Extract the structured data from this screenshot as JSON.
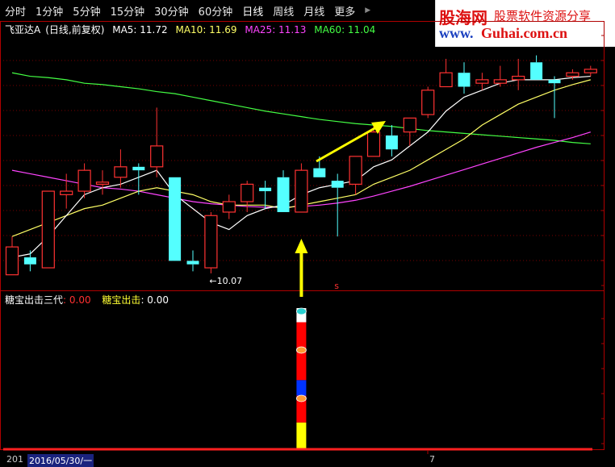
{
  "toolbar": {
    "tabs": [
      "分时",
      "1分钟",
      "5分钟",
      "15分钟",
      "30分钟",
      "60分钟",
      "日线",
      "周线",
      "月线",
      "更多"
    ],
    "active": "日线",
    "more_arrow": "▶"
  },
  "logo": {
    "name": "股海网",
    "slogan": "股票软件资源分享",
    "url_prefix": "www.",
    "url_domain": "Guhai.com.cn"
  },
  "main_info": {
    "stock": "飞亚达A",
    "mode": "(日线,前复权)",
    "ma5": "MA5: 11.72",
    "ma10": "MA10: 11.69",
    "ma25": "MA25: 11.13",
    "ma60": "MA60: 11.04",
    "colors": {
      "stock": "#ffffff",
      "ma5": "#ffffff",
      "ma10": "#ffff66",
      "ma25": "#ff44ff",
      "ma60": "#44ff44"
    }
  },
  "low_marker": "←10.07",
  "s_marker": "s",
  "indicator": {
    "name1": "糖宝出击三代",
    "val1": ": 0.00",
    "name2": "糖宝出击",
    "val2": ": 0.00"
  },
  "status": {
    "year_prefix": "201",
    "date": "2016/05/30/一",
    "tick_label": "7"
  },
  "chart_data": {
    "type": "candlestick",
    "candles": [
      {
        "o": 10.05,
        "c": 10.45,
        "h": 10.6,
        "l": 10.05
      },
      {
        "o": 10.3,
        "c": 10.2,
        "h": 10.4,
        "l": 10.1
      },
      {
        "o": 10.15,
        "c": 11.25,
        "h": 11.25,
        "l": 10.15
      },
      {
        "o": 11.2,
        "c": 11.25,
        "h": 11.5,
        "l": 11.0
      },
      {
        "o": 11.25,
        "c": 11.55,
        "h": 11.65,
        "l": 11.15
      },
      {
        "o": 11.35,
        "c": 11.38,
        "h": 11.55,
        "l": 11.2
      },
      {
        "o": 11.45,
        "c": 11.6,
        "h": 11.85,
        "l": 11.3
      },
      {
        "o": 11.6,
        "c": 11.55,
        "h": 11.65,
        "l": 11.2
      },
      {
        "o": 11.6,
        "c": 11.9,
        "h": 12.45,
        "l": 11.45
      },
      {
        "o": 11.45,
        "c": 10.25,
        "h": 11.45,
        "l": 10.25
      },
      {
        "o": 10.25,
        "c": 10.2,
        "h": 10.4,
        "l": 10.1
      },
      {
        "o": 10.15,
        "c": 10.9,
        "h": 10.95,
        "l": 10.07
      },
      {
        "o": 10.95,
        "c": 11.1,
        "h": 11.2,
        "l": 10.85
      },
      {
        "o": 11.1,
        "c": 11.35,
        "h": 11.4,
        "l": 10.95
      },
      {
        "o": 11.3,
        "c": 11.25,
        "h": 11.4,
        "l": 11.0
      },
      {
        "o": 11.45,
        "c": 10.95,
        "h": 11.55,
        "l": 10.95
      },
      {
        "o": 10.95,
        "c": 11.55,
        "h": 11.65,
        "l": 10.95
      },
      {
        "o": 11.58,
        "c": 11.45,
        "h": 11.75,
        "l": 11.45
      },
      {
        "o": 11.4,
        "c": 11.3,
        "h": 11.5,
        "l": 10.6
      },
      {
        "o": 11.35,
        "c": 11.75,
        "h": 11.75,
        "l": 11.2
      },
      {
        "o": 11.75,
        "c": 12.1,
        "h": 12.2,
        "l": 11.75
      },
      {
        "o": 12.05,
        "c": 11.85,
        "h": 12.2,
        "l": 11.75
      },
      {
        "o": 12.1,
        "c": 12.3,
        "h": 12.3,
        "l": 11.9
      },
      {
        "o": 12.35,
        "c": 12.7,
        "h": 12.75,
        "l": 12.3
      },
      {
        "o": 12.75,
        "c": 12.95,
        "h": 13.15,
        "l": 12.75
      },
      {
        "o": 12.95,
        "c": 12.75,
        "h": 13.1,
        "l": 12.65
      },
      {
        "o": 12.8,
        "c": 12.85,
        "h": 12.95,
        "l": 12.7
      },
      {
        "o": 12.8,
        "c": 12.85,
        "h": 13.05,
        "l": 12.75
      },
      {
        "o": 12.85,
        "c": 12.9,
        "h": 13.15,
        "l": 12.7
      },
      {
        "o": 13.1,
        "c": 12.85,
        "h": 13.2,
        "l": 12.85
      },
      {
        "o": 12.85,
        "c": 12.8,
        "h": 12.9,
        "l": 12.3
      },
      {
        "o": 12.9,
        "c": 12.95,
        "h": 13.0,
        "l": 12.85
      },
      {
        "o": 12.95,
        "c": 13.0,
        "h": 13.05,
        "l": 12.9
      }
    ],
    "ma5": [
      10.3,
      10.35,
      10.6,
      10.9,
      11.2,
      11.3,
      11.35,
      11.45,
      11.55,
      11.2,
      11.0,
      10.8,
      10.7,
      10.9,
      11.0,
      11.05,
      11.2,
      11.3,
      11.35,
      11.4,
      11.6,
      11.7,
      11.9,
      12.1,
      12.4,
      12.6,
      12.7,
      12.8,
      12.85,
      12.85,
      12.85,
      12.88,
      12.9
    ],
    "ma10": [
      10.6,
      10.7,
      10.8,
      10.9,
      11.0,
      11.05,
      11.15,
      11.25,
      11.3,
      11.25,
      11.2,
      11.1,
      11.05,
      11.05,
      11.05,
      11.0,
      11.05,
      11.1,
      11.15,
      11.2,
      11.35,
      11.45,
      11.55,
      11.7,
      11.85,
      12.0,
      12.2,
      12.35,
      12.5,
      12.6,
      12.7,
      12.78,
      12.85
    ],
    "ma25": [
      11.55,
      11.5,
      11.45,
      11.4,
      11.35,
      11.3,
      11.28,
      11.25,
      11.2,
      11.15,
      11.1,
      11.07,
      11.05,
      11.03,
      11.02,
      11.02,
      11.03,
      11.05,
      11.08,
      11.12,
      11.18,
      11.25,
      11.32,
      11.4,
      11.48,
      11.56,
      11.64,
      11.72,
      11.8,
      11.88,
      11.95,
      12.02,
      12.1
    ],
    "ma60": [
      12.95,
      12.9,
      12.88,
      12.85,
      12.8,
      12.78,
      12.75,
      12.72,
      12.68,
      12.65,
      12.6,
      12.55,
      12.5,
      12.45,
      12.4,
      12.36,
      12.32,
      12.28,
      12.25,
      12.22,
      12.2,
      12.18,
      12.15,
      12.12,
      12.1,
      12.08,
      12.06,
      12.04,
      12.02,
      12.0,
      11.98,
      11.95,
      11.93
    ],
    "indicator_bars": [
      {
        "i": 16,
        "segments": [
          [
            "#ffff00",
            0,
            0.19
          ],
          [
            "#ff0000",
            0.19,
            0.38
          ],
          [
            "#0033ff",
            0.38,
            0.49
          ],
          [
            "#ff0000",
            0.49,
            0.9
          ],
          [
            "#ffffff",
            0.9,
            1.0
          ]
        ]
      }
    ]
  }
}
